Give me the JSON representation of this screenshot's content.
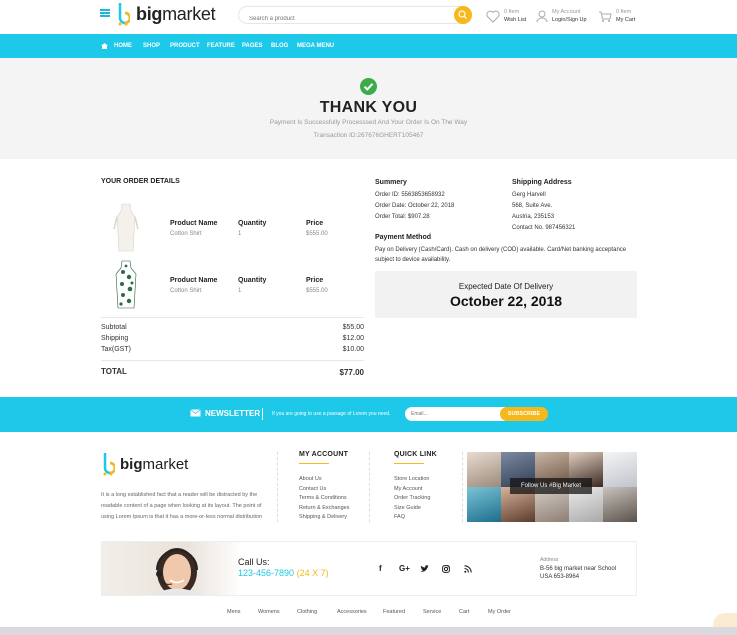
{
  "header": {
    "logo_text_bold": "big",
    "logo_text": "market",
    "search_placeholder": "Search a product",
    "wishlist_count": "0 Item",
    "wishlist_label": "Wish List",
    "account_label_top": "My Account",
    "account_label": "Login/Sign Up",
    "cart_count": "0 Item",
    "cart_label": "My Cart"
  },
  "nav": {
    "home": "HOME",
    "shop": "SHOP",
    "product": "PRODUCT",
    "feature": "FEATURE",
    "pages": "PAGES",
    "blog": "BLOG",
    "mega_menu": "MEGA MENU"
  },
  "hero": {
    "title": "THANK YOU",
    "message": "Payment Is Successfully Processsed And Your Order Is On The Way",
    "transaction": "Transaction ID:267676GHERT105467"
  },
  "order": {
    "title": "YOUR ORDER DETAILS",
    "items": [
      {
        "name_label": "Product Name",
        "name": "Cotton Shirt",
        "qty_label": "Quantity",
        "qty": "1",
        "price_label": "Price",
        "price": "$555.00"
      },
      {
        "name_label": "Product Name",
        "name": "Cotton Shirt",
        "qty_label": "Quantity",
        "qty": "1",
        "price_label": "Price",
        "price": "$555.00"
      }
    ],
    "subtotal_label": "Subtotal",
    "subtotal": "$55.00",
    "shipping_label": "Shipping",
    "shipping": "$12.00",
    "tax_label": "Tax(GST)",
    "tax": "$10.00",
    "total_label": "TOTAL",
    "total": "$77.00"
  },
  "summary": {
    "title": "Summery",
    "order_id": "Order ID: 5563853658932",
    "order_date": "Order Date: October 22, 2018",
    "order_total": "Order Total: $907.28"
  },
  "shipping_address": {
    "title": "Shipping Address",
    "name": "Gerg Harvell",
    "line1": "568, Suite Ave.",
    "line2": "Austria, 235153",
    "contact": "Contact No. 987456321"
  },
  "payment": {
    "title": "Payment Method",
    "text_line1": "Pay on Delivery (Cash/Card). Cash on delivery (COD) available. Card/Net banking acceptance",
    "text_line2": "subject to device availability."
  },
  "delivery": {
    "label": "Expected Date Of Delivery",
    "date": "October 22, 2018"
  },
  "newsletter": {
    "title": "NEWSLETTER",
    "text": "If you are going to use a passage of Lorem you need.",
    "placeholder": "Email...",
    "button": "SUBSCRIBE"
  },
  "footer": {
    "about_line1": "It is a long established fact that a reader will be distracted by the",
    "about_line2": "readable content of a page when looking at its layout. The point of",
    "about_line3": "using Lorem Ipsum is that it has a more-or-less normal distribution",
    "my_account": {
      "title": "MY ACCOUNT",
      "links": [
        "About Us",
        "Contact Us",
        "Terms & Conditions",
        "Return & Exchanges",
        "Shipping & Delivery"
      ]
    },
    "quick_link": {
      "title": "QUICK LINK",
      "links": [
        "Store Location",
        "My Account",
        "Order Tracking",
        "Size Guide",
        "FAQ"
      ]
    },
    "instagram_label": "Follow Us #Big Market",
    "call_label": "Call Us:",
    "phone": "123-456-7890",
    "phone_hours": "(24 X 7)",
    "address_label": "Address",
    "address_line1": "B-56 big market near School",
    "address_line2": "USA 653-8964",
    "bottom_links": [
      "Mens",
      "Womens",
      "Clothing",
      "Accessories",
      "Featured",
      "Service",
      "Cart",
      "My Order"
    ]
  },
  "colors": {
    "brand_cyan": "#1ec8e8",
    "accent_yellow": "#f6b81a",
    "success_green": "#3cac4b"
  }
}
